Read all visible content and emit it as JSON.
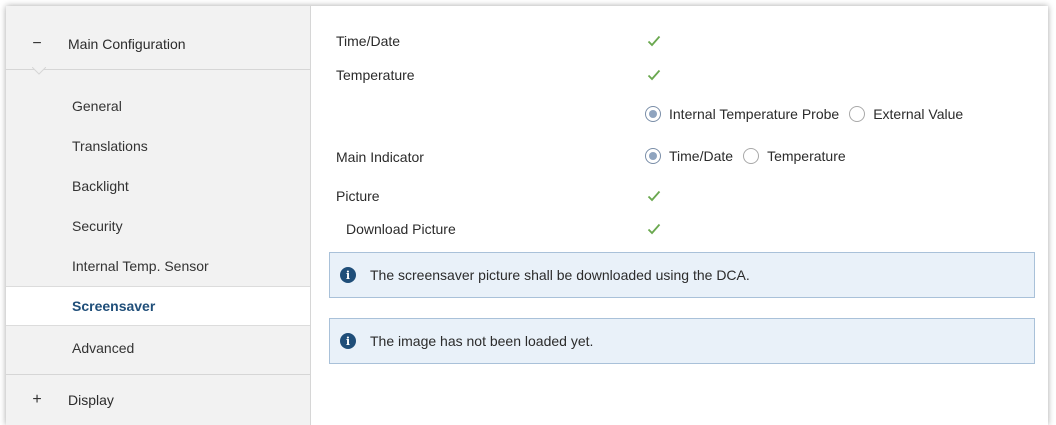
{
  "sidebar": {
    "main_group": {
      "expander": "−",
      "label": "Main Configuration"
    },
    "items": [
      {
        "label": "General"
      },
      {
        "label": "Translations"
      },
      {
        "label": "Backlight"
      },
      {
        "label": "Security"
      },
      {
        "label": "Internal Temp. Sensor"
      },
      {
        "label": "Screensaver",
        "active": true
      },
      {
        "label": "Advanced"
      }
    ],
    "display_group": {
      "expander": "+",
      "label": "Display"
    }
  },
  "main": {
    "time_date": {
      "label": "Time/Date",
      "checked": true
    },
    "temperature": {
      "label": "Temperature",
      "checked": true,
      "options": [
        "Internal Temperature Probe",
        "External Value"
      ],
      "selected": "Internal Temperature Probe"
    },
    "main_indicator": {
      "label": "Main Indicator",
      "options": [
        "Time/Date",
        "Temperature"
      ],
      "selected": "Time/Date"
    },
    "picture": {
      "label": "Picture",
      "checked": true
    },
    "download_picture": {
      "label": "Download Picture",
      "checked": true
    },
    "info_messages": [
      "The screensaver picture shall be downloaded using the DCA.",
      "The image has not been loaded yet."
    ]
  },
  "colors": {
    "accent": "#1f4e79",
    "check": "#6aa84f",
    "info_bg": "#e9f1f9",
    "info_border": "#a9c1d9"
  }
}
